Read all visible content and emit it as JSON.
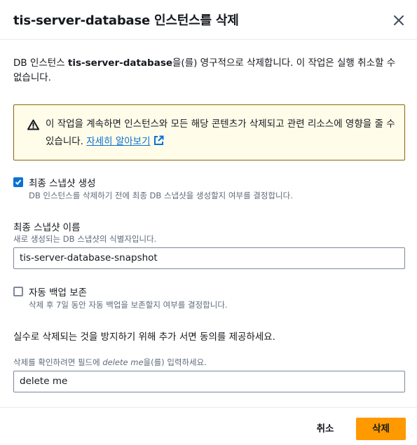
{
  "dialog": {
    "title": "tis-server-database 인스턴스를 삭제",
    "close_icon": "close-icon"
  },
  "description": {
    "prefix": "DB 인스턴스 ",
    "instance_name": "tis-server-database",
    "suffix": "을(를) 영구적으로 삭제합니다. 이 작업은 실행 취소할 수 없습니다."
  },
  "warning": {
    "icon": "warning-icon",
    "text": "이 작업을 계속하면 인스턴스와 모든 해당 콘텐츠가 삭제되고 관련 리소스에 영향을 줄 수 있습니다. ",
    "link_text": "자세히 알아보기",
    "link_icon": "external-link-icon"
  },
  "final_snapshot": {
    "checked": true,
    "label": "최종 스냅샷 생성",
    "hint": "DB 인스턴스를 삭제하기 전에 최종 DB 스냅샷을 생성할지 여부를 결정합니다."
  },
  "snapshot_name": {
    "label": "최종 스냅샷 이름",
    "hint": "새로 생성되는 DB 스냅샷의 식별자입니다.",
    "value": "tis-server-database-snapshot"
  },
  "retain_backups": {
    "checked": false,
    "label": "자동 백업 보존",
    "hint": "삭제 후 7일 동안 자동 백업을 보존할지 여부를 결정합니다."
  },
  "confirm": {
    "instruction": "실수로 삭제되는 것을 방지하기 위해 추가 서면 동의를 제공하세요.",
    "hint_prefix": "삭제를 확인하려면 필드에 ",
    "hint_keyword": "delete me",
    "hint_suffix": "을(를) 입력하세요.",
    "value": "delete me"
  },
  "footer": {
    "cancel_label": "취소",
    "delete_label": "삭제"
  },
  "colors": {
    "accent": "#0972d3",
    "primary_button": "#ff9900",
    "warning_bg": "#fffce9",
    "warning_border": "#8d6605"
  }
}
